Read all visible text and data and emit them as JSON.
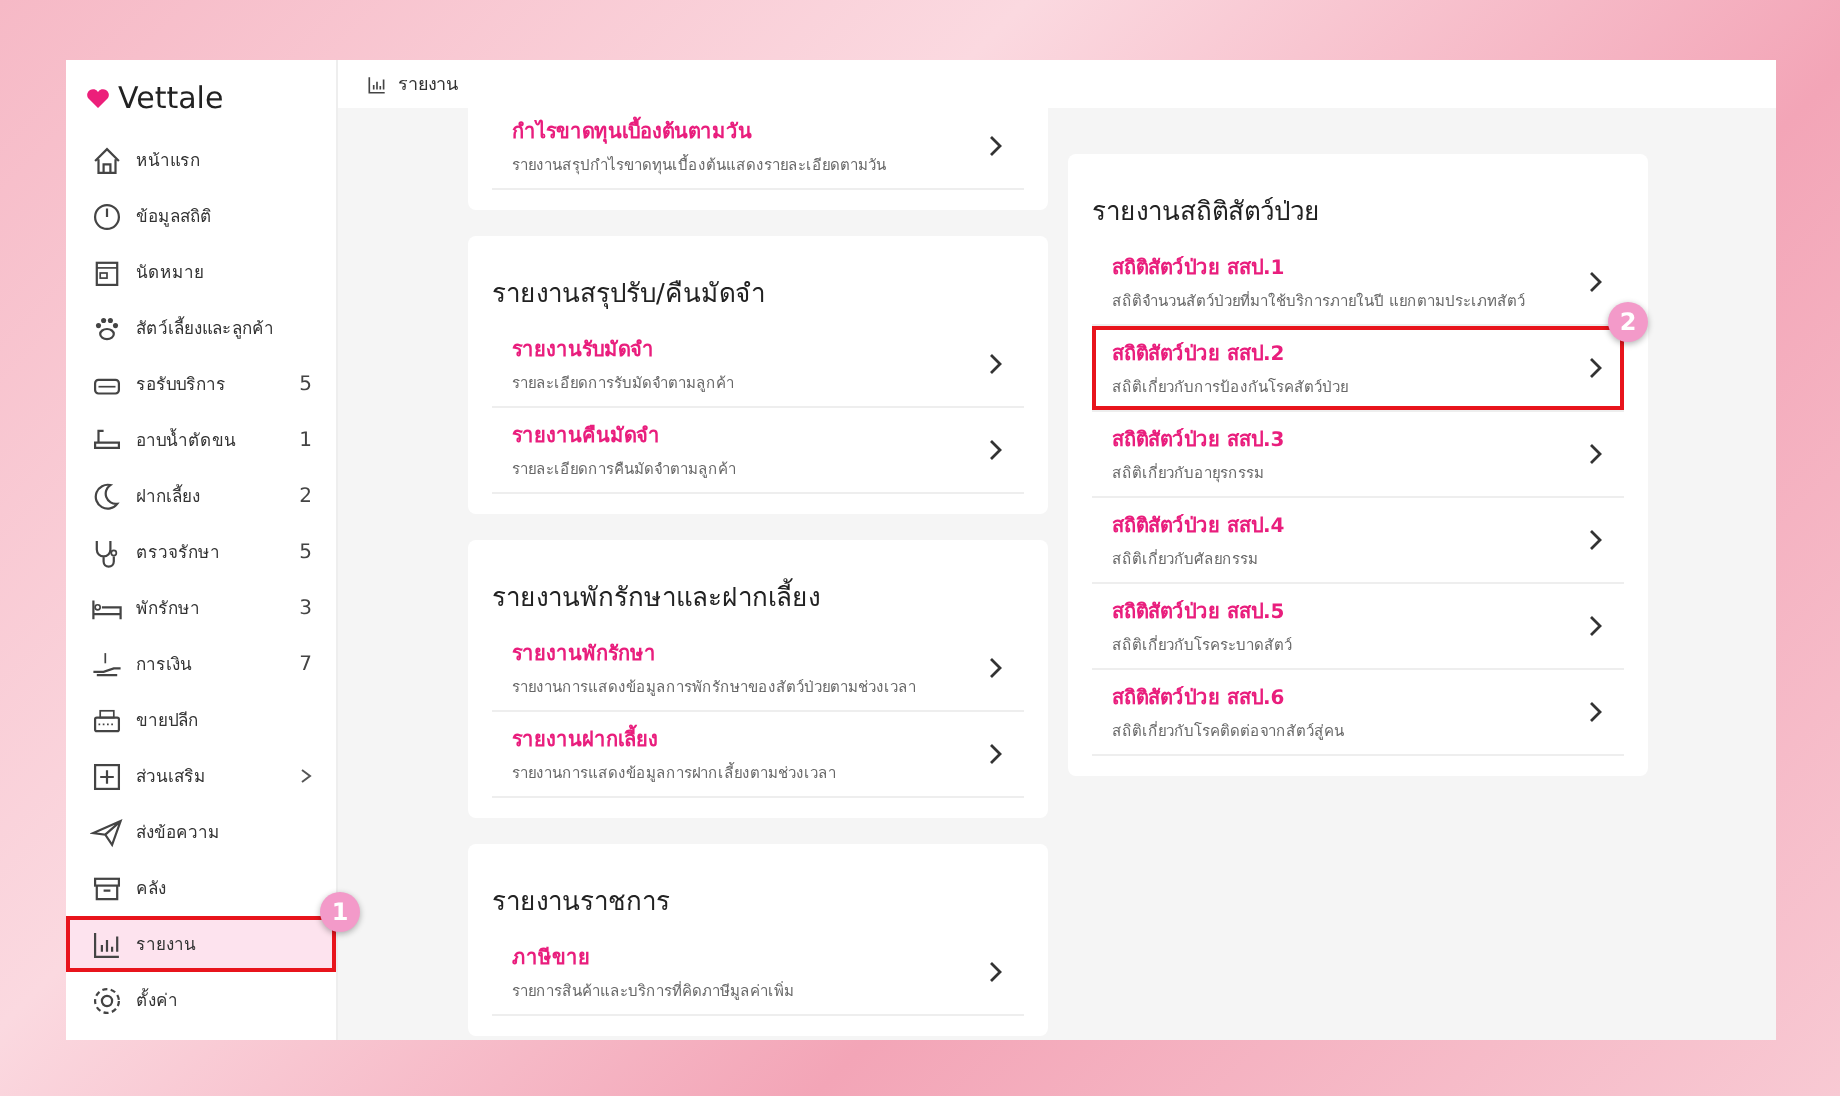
{
  "app": {
    "logo": "Vettale"
  },
  "sidebar": {
    "items": [
      {
        "label": "หน้าแรก",
        "selected": false
      },
      {
        "label": "ข้อมูลสถิติ",
        "selected": false
      },
      {
        "label": "นัดหมาย",
        "selected": false
      },
      {
        "label": "สัตว์เลี้ยงและลูกค้า",
        "selected": false
      },
      {
        "label": "รอรับบริการ",
        "count": "5",
        "selected": false
      },
      {
        "label": "อาบน้ำตัดขน",
        "count": "1",
        "selected": false
      },
      {
        "label": "ฝากเลี้ยง",
        "count": "2",
        "selected": false
      },
      {
        "label": "ตรวจรักษา",
        "count": "5",
        "selected": false
      },
      {
        "label": "พักรักษา",
        "count": "3",
        "selected": false
      },
      {
        "label": "การเงิน",
        "count": "7",
        "selected": false
      },
      {
        "label": "ขายปลีก",
        "selected": false
      },
      {
        "label": "ส่วนเสริม",
        "expandable": true,
        "selected": false
      },
      {
        "label": "ส่งข้อความ",
        "selected": false
      },
      {
        "label": "คลัง",
        "selected": false
      },
      {
        "label": "รายงาน",
        "selected": true,
        "callout": "1"
      },
      {
        "label": "ตั้งค่า",
        "selected": false
      }
    ]
  },
  "breadcrumb": "รายงาน",
  "left_column": [
    {
      "items": [
        {
          "title": "กำไรขาดทุนเบื้องต้นตามวัน",
          "description": "รายงานสรุปกำไรขาดทุนเบื้องต้นแสดงรายละเอียดตามวัน"
        }
      ]
    },
    {
      "heading": "รายงานสรุปรับ/คืนมัดจำ",
      "items": [
        {
          "title": "รายงานรับมัดจำ",
          "description": "รายละเอียดการรับมัดจำตามลูกค้า"
        },
        {
          "title": "รายงานคืนมัดจำ",
          "description": "รายละเอียดการคืนมัดจำตามลูกค้า"
        }
      ]
    },
    {
      "heading": "รายงานพักรักษาและฝากเลี้ยง",
      "items": [
        {
          "title": "รายงานพักรักษา",
          "description": "รายงานการแสดงข้อมูลการพักรักษาของสัตว์ป่วยตามช่วงเวลา"
        },
        {
          "title": "รายงานฝากเลี้ยง",
          "description": "รายงานการแสดงข้อมูลการฝากเลี้ยงตามช่วงเวลา"
        }
      ]
    },
    {
      "heading": "รายงานราชการ",
      "items": [
        {
          "title": "ภาษีขาย",
          "description": "รายการสินค้าและบริการที่คิดภาษีมูลค่าเพิ่ม"
        }
      ]
    }
  ],
  "right_column": [
    {
      "heading": "รายงานสถิติสัตว์ป่วย",
      "items": [
        {
          "title": "สถิติสัตว์ป่วย สสป.1",
          "description": "สถิติจำนวนสัตว์ป่วยที่มาใช้บริการภายในปี แยกตามประเภทสัตว์"
        },
        {
          "title": "สถิติสัตว์ป่วย สสป.2",
          "description": "สถิติเกี่ยวกับการป้องกันโรคสัตว์ป่วย",
          "callout": "2"
        },
        {
          "title": "สถิติสัตว์ป่วย สสป.3",
          "description": "สถิติเกี่ยวกับอายุรกรรม"
        },
        {
          "title": "สถิติสัตว์ป่วย สสป.4",
          "description": "สถิติเกี่ยวกับศัลยกรรม"
        },
        {
          "title": "สถิติสัตว์ป่วย สสป.5",
          "description": "สถิติเกี่ยวกับโรคระบาดสัตว์"
        },
        {
          "title": "สถิติสัตว์ป่วย สสป.6",
          "description": "สถิติเกี่ยวกับโรคติดต่อจากสัตว์สู่คน"
        }
      ]
    }
  ]
}
